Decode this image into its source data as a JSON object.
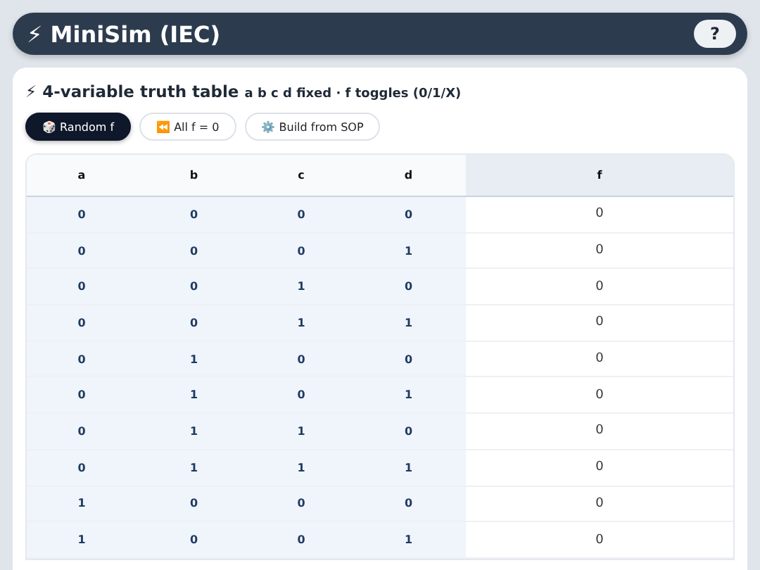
{
  "app_bar": {
    "title": "⚡ MiniSim (IEC)",
    "help_button": "?"
  },
  "card": {
    "title": "⚡ 4-variable truth table",
    "subtitle": "a b c d fixed · f toggles (0/1/X)",
    "buttons": [
      {
        "label": "🎲 Random f",
        "selected": true
      },
      {
        "label": "⏪ All f = 0",
        "selected": false
      },
      {
        "label": "⚙️ Build from SOP",
        "selected": false
      }
    ],
    "table": {
      "columns": [
        "a",
        "b",
        "c",
        "d",
        "f"
      ],
      "rows": [
        [
          "0",
          "0",
          "0",
          "0",
          "0"
        ],
        [
          "0",
          "0",
          "0",
          "1",
          "0"
        ],
        [
          "0",
          "0",
          "1",
          "0",
          "0"
        ],
        [
          "0",
          "0",
          "1",
          "1",
          "0"
        ],
        [
          "0",
          "1",
          "0",
          "0",
          "0"
        ],
        [
          "0",
          "1",
          "0",
          "1",
          "0"
        ],
        [
          "0",
          "1",
          "1",
          "0",
          "0"
        ],
        [
          "0",
          "1",
          "1",
          "1",
          "0"
        ],
        [
          "1",
          "0",
          "0",
          "0",
          "0"
        ],
        [
          "1",
          "0",
          "0",
          "1",
          "0"
        ]
      ]
    }
  }
}
